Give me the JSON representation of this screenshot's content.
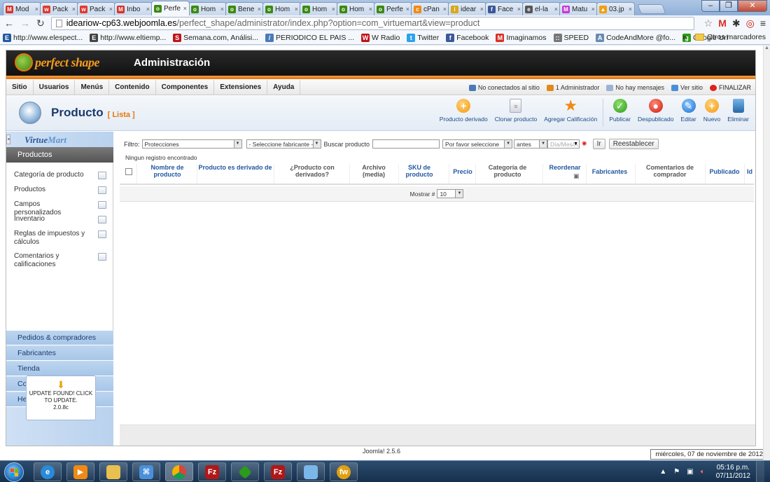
{
  "browser": {
    "tabs": [
      {
        "label": "Mod",
        "fav": "M",
        "color": "#d93025"
      },
      {
        "label": "Pack",
        "fav": "w",
        "color": "#e03a2f"
      },
      {
        "label": "Pack",
        "fav": "w",
        "color": "#e03a2f"
      },
      {
        "label": "Inbo",
        "fav": "M",
        "color": "#d93025"
      },
      {
        "label": "Perfe",
        "fav": "o",
        "color": "#3a8a12",
        "active": true
      },
      {
        "label": "Hom",
        "fav": "o",
        "color": "#3a8a12"
      },
      {
        "label": "Bene",
        "fav": "o",
        "color": "#3a8a12"
      },
      {
        "label": "Hom",
        "fav": "o",
        "color": "#3a8a12"
      },
      {
        "label": "Hom",
        "fav": "o",
        "color": "#3a8a12"
      },
      {
        "label": "Hom",
        "fav": "o",
        "color": "#3a8a12"
      },
      {
        "label": "Perfe",
        "fav": "o",
        "color": "#3a8a12"
      },
      {
        "label": "cPan",
        "fav": "c",
        "color": "#f08a14"
      },
      {
        "label": "idear",
        "fav": "i",
        "color": "#d9a81a"
      },
      {
        "label": "Face",
        "fav": "f",
        "color": "#3b5998"
      },
      {
        "label": "el-la",
        "fav": "e",
        "color": "#555555"
      },
      {
        "label": "Matu",
        "fav": "M",
        "color": "#c23ad6"
      },
      {
        "label": "03.jp",
        "fav": "▲",
        "color": "#f0a010"
      }
    ],
    "tab_close": "×",
    "url_host": "ideariow-cp63.webjoomla.es",
    "url_path": "/perfect_shape/administrator/index.php?option=com_virtuemart&view=product",
    "bookmarks": [
      {
        "label": "http://www.elespect...",
        "icon": "E",
        "color": "#2358a0"
      },
      {
        "label": "http://www.eltiemp...",
        "icon": "E",
        "color": "#444444"
      },
      {
        "label": "Semana.com, Análisi...",
        "icon": "S",
        "color": "#c0141a"
      },
      {
        "label": "PERIODICO EL PAIS ...",
        "icon": "/",
        "color": "#4a7ab8"
      },
      {
        "label": "W Radio",
        "icon": "W",
        "color": "#c0141a"
      },
      {
        "label": "Twitter",
        "icon": "t",
        "color": "#2aa3ef"
      },
      {
        "label": "Facebook",
        "icon": "f",
        "color": "#3b5998"
      },
      {
        "label": "Imaginamos",
        "icon": "M",
        "color": "#d93025"
      },
      {
        "label": "SPEED",
        "icon": "::",
        "color": "#777777"
      },
      {
        "label": "CodeAndMore @fo...",
        "icon": "A",
        "color": "#6a8ab0"
      },
      {
        "label": "Google Url",
        "icon": "g",
        "color": "#2c9a1a"
      }
    ],
    "bookmarks_more": "»",
    "other_bookmarks": "Otros marcadores"
  },
  "admin": {
    "logo_text": "perfect shape",
    "title": "Administración",
    "menu": [
      "Sitio",
      "Usuarios",
      "Menús",
      "Contenido",
      "Componentes",
      "Extensiones",
      "Ayuda"
    ],
    "status": [
      {
        "label": "No conectados al sitio",
        "color": "#4a7ab8"
      },
      {
        "label": "1 Administrador",
        "color": "#e08a1a"
      },
      {
        "label": "No hay mensajes",
        "color": "#9ab4d4"
      },
      {
        "label": "Ver sitio",
        "color": "#4a90d9"
      }
    ],
    "logout": "FINALIZAR",
    "page_title": "Producto",
    "page_subtitle": "[ Lista ]",
    "toolbar": [
      {
        "label": "Producto derivado",
        "style": "orange",
        "glyph": "+"
      },
      {
        "label": "Clonar producto",
        "style": "doc",
        "glyph": "≡"
      },
      {
        "label": "Agregar Calificación",
        "style": "star",
        "glyph": "★"
      },
      {
        "label": "Publicar",
        "style": "green",
        "glyph": "✓"
      },
      {
        "label": "Despublicado",
        "style": "red",
        "glyph": "●"
      },
      {
        "label": "Editar",
        "style": "blue",
        "glyph": "✎"
      },
      {
        "label": "Nuevo",
        "style": "orange",
        "glyph": "+"
      },
      {
        "label": "Eliminar",
        "style": "trash",
        "glyph": ""
      }
    ]
  },
  "sidebar": {
    "logo_main": "Virtue",
    "logo_accent": "Mart",
    "active_section": "Productos",
    "items": [
      "Categoría de producto",
      "Productos",
      "Campos personalizados",
      "Inventario",
      "Reglas de impuestos y cálculos",
      "Comentarios y calificaciones"
    ],
    "sections": [
      "Pedidos & compradores",
      "Fabricantes",
      "Tienda",
      "Configuración",
      "Herramientas"
    ],
    "update_lines": [
      "UPDATE FOUND! CLICK",
      "TO UPDATE.",
      "2.0.8c"
    ]
  },
  "filters": {
    "filter_label": "Filtro:",
    "filter_value": "Protecciones",
    "manufacturer_value": "- Seleccione fabricante -",
    "search_label": "Buscar producto",
    "search_value": "",
    "please_select": "Por favor seleccione",
    "before_value": "antes",
    "date_placeholder": "Día/Mes/A",
    "go": "Ir",
    "reset": "Reestablecer",
    "no_records": "Ningun registro encontrado"
  },
  "table": {
    "columns": [
      {
        "label": "Nombre de producto"
      },
      {
        "label": "Producto es derivado de"
      },
      {
        "label": "¿Producto con derivados?"
      },
      {
        "label": "Archivo (media)"
      },
      {
        "label": "SKU de producto"
      },
      {
        "label": "Precio"
      },
      {
        "label": "Categoría de producto"
      },
      {
        "label": "Reordenar"
      },
      {
        "label": "Fabricantes"
      },
      {
        "label": "Comentarios de comprador"
      },
      {
        "label": "Publicado"
      },
      {
        "label": "Id"
      }
    ],
    "show_label": "Mostrar #",
    "show_value": "10"
  },
  "footer": {
    "joomla_version": "Joomla! 2.5.6",
    "date_tooltip": "miércoles, 07 de noviembre de 2012"
  },
  "taskbar": {
    "time": "05:16 p.m.",
    "date": "07/11/2012"
  }
}
